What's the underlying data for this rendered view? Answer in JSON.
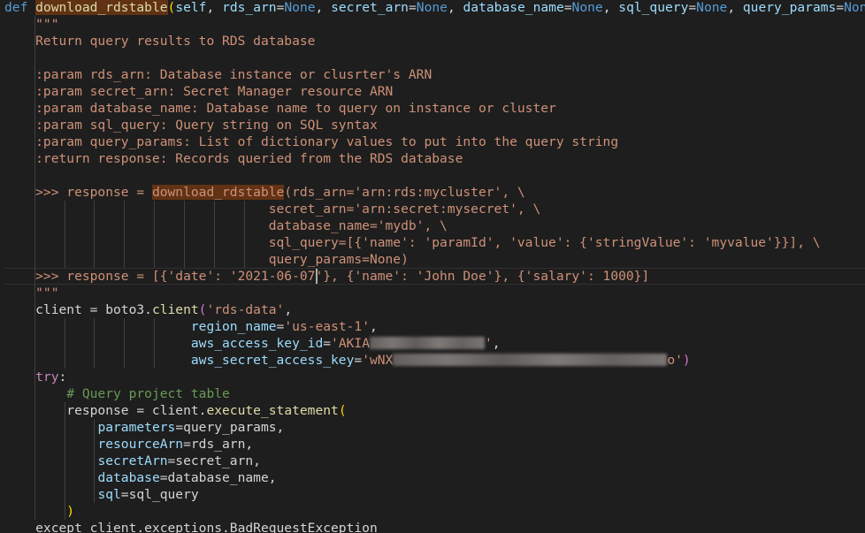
{
  "editor": {
    "lines": [
      [
        {
          "t": "def",
          "c": "kw"
        },
        {
          "t": " ",
          "c": "txt"
        },
        {
          "t": "download_rdstable",
          "c": "fn hl"
        },
        {
          "t": "(",
          "c": "br"
        },
        {
          "t": "self",
          "c": "pm"
        },
        {
          "t": ", ",
          "c": "txt"
        },
        {
          "t": "rds_arn",
          "c": "pm"
        },
        {
          "t": "=",
          "c": "txt"
        },
        {
          "t": "None",
          "c": "co"
        },
        {
          "t": ", ",
          "c": "txt"
        },
        {
          "t": "secret_arn",
          "c": "pm"
        },
        {
          "t": "=",
          "c": "txt"
        },
        {
          "t": "None",
          "c": "co"
        },
        {
          "t": ", ",
          "c": "txt"
        },
        {
          "t": "database_name",
          "c": "pm"
        },
        {
          "t": "=",
          "c": "txt"
        },
        {
          "t": "None",
          "c": "co"
        },
        {
          "t": ", ",
          "c": "txt"
        },
        {
          "t": "sql_query",
          "c": "pm"
        },
        {
          "t": "=",
          "c": "txt"
        },
        {
          "t": "None",
          "c": "co"
        },
        {
          "t": ", ",
          "c": "txt"
        },
        {
          "t": "query_params",
          "c": "pm"
        },
        {
          "t": "=",
          "c": "txt"
        },
        {
          "t": "None",
          "c": "co"
        },
        {
          "t": ")",
          "c": "br"
        },
        {
          "t": ":",
          "c": "txt"
        }
      ],
      [
        {
          "t": "    \"\"\"",
          "c": "st"
        }
      ],
      [
        {
          "t": "    Return query results to RDS database",
          "c": "st"
        }
      ],
      [],
      [
        {
          "t": "    :param rds_arn: Database instance or clusrter's ARN",
          "c": "st"
        }
      ],
      [
        {
          "t": "    :param secret_arn: Secret Manager resource ARN",
          "c": "st"
        }
      ],
      [
        {
          "t": "    :param database_name: Database name to query on instance or cluster",
          "c": "st"
        }
      ],
      [
        {
          "t": "    :param sql_query: Query string on SQL syntax",
          "c": "st"
        }
      ],
      [
        {
          "t": "    :param query_params: List of dictionary values to put into the query string",
          "c": "st"
        }
      ],
      [
        {
          "t": "    :return response: Records queried from the RDS database",
          "c": "st"
        }
      ],
      [],
      [
        {
          "t": "    >>> response = ",
          "c": "st"
        },
        {
          "t": "download_rdstable",
          "c": "st hl"
        },
        {
          "t": "(rds_arn='arn:rds:mycluster', \\",
          "c": "st"
        }
      ],
      [
        {
          "t": "                                  secret_arn='arn:secret:mysecret', \\",
          "c": "st"
        }
      ],
      [
        {
          "t": "                                  database_name='mydb', \\",
          "c": "st"
        }
      ],
      [
        {
          "t": "                                  sql_query=[{'name': 'paramId', 'value': {'stringValue': 'myvalue'}}], \\",
          "c": "st"
        }
      ],
      [
        {
          "t": "                                  query_params=None)",
          "c": "st"
        }
      ],
      [
        {
          "t": "    >>> response = [{'date': '2021-06-07'}, {'name': 'John Doe'}, {'salary': 1000}]",
          "c": "st"
        }
      ],
      [
        {
          "t": "    \"\"\"",
          "c": "st"
        }
      ],
      [
        {
          "t": "    client = boto3.",
          "c": "txt"
        },
        {
          "t": "client",
          "c": "fn"
        },
        {
          "t": "(",
          "c": "br2"
        },
        {
          "t": "'rds-data'",
          "c": "st"
        },
        {
          "t": ",",
          "c": "txt"
        }
      ],
      [
        {
          "t": "                        ",
          "c": "txt"
        },
        {
          "t": "region_name",
          "c": "pm"
        },
        {
          "t": "=",
          "c": "txt"
        },
        {
          "t": "'us-east-1'",
          "c": "st"
        },
        {
          "t": ",",
          "c": "txt"
        }
      ],
      [
        {
          "t": "                        ",
          "c": "txt"
        },
        {
          "t": "aws_access_key_id",
          "c": "pm"
        },
        {
          "t": "=",
          "c": "txt"
        },
        {
          "t": "'AKIA",
          "c": "st"
        },
        {
          "t": "\u0000A",
          "c": "blur"
        },
        {
          "t": "'",
          "c": "st"
        },
        {
          "t": ",",
          "c": "txt"
        }
      ],
      [
        {
          "t": "                        ",
          "c": "txt"
        },
        {
          "t": "aws_secret_access_key",
          "c": "pm"
        },
        {
          "t": "=",
          "c": "txt"
        },
        {
          "t": "'wNX",
          "c": "st"
        },
        {
          "t": "\u0000B",
          "c": "blur"
        },
        {
          "t": "o'",
          "c": "st"
        },
        {
          "t": ")",
          "c": "br2"
        }
      ],
      [
        {
          "t": "    ",
          "c": "txt"
        },
        {
          "t": "try",
          "c": "ctl"
        },
        {
          "t": ":",
          "c": "txt"
        }
      ],
      [
        {
          "t": "        # Query project table",
          "c": "cm"
        }
      ],
      [
        {
          "t": "        response = client.",
          "c": "txt"
        },
        {
          "t": "execute_statement",
          "c": "fn"
        },
        {
          "t": "(",
          "c": "br"
        }
      ],
      [
        {
          "t": "            ",
          "c": "txt"
        },
        {
          "t": "parameters",
          "c": "pm"
        },
        {
          "t": "=query_params,",
          "c": "txt"
        }
      ],
      [
        {
          "t": "            ",
          "c": "txt"
        },
        {
          "t": "resourceArn",
          "c": "pm"
        },
        {
          "t": "=rds_arn,",
          "c": "txt"
        }
      ],
      [
        {
          "t": "            ",
          "c": "txt"
        },
        {
          "t": "secretArn",
          "c": "pm"
        },
        {
          "t": "=secret_arn,",
          "c": "txt"
        }
      ],
      [
        {
          "t": "            ",
          "c": "txt"
        },
        {
          "t": "database",
          "c": "pm"
        },
        {
          "t": "=database_name,",
          "c": "txt"
        }
      ],
      [
        {
          "t": "            ",
          "c": "txt"
        },
        {
          "t": "sql",
          "c": "pm"
        },
        {
          "t": "=sql_query",
          "c": "txt"
        }
      ],
      [
        {
          "t": "        ",
          "c": "txt"
        },
        {
          "t": ")",
          "c": "br"
        }
      ],
      [
        {
          "t": "    except client.exceptions.BadRequestException",
          "c": "txt"
        }
      ]
    ],
    "colors": {
      "background": "#1e1e1e",
      "keyword": "#569cd6",
      "function": "#dcdcaa",
      "string": "#ce9178",
      "parameter": "#9cdcfe",
      "comment": "#6a9955",
      "control": "#c586c0",
      "highlight": "#613214"
    }
  }
}
